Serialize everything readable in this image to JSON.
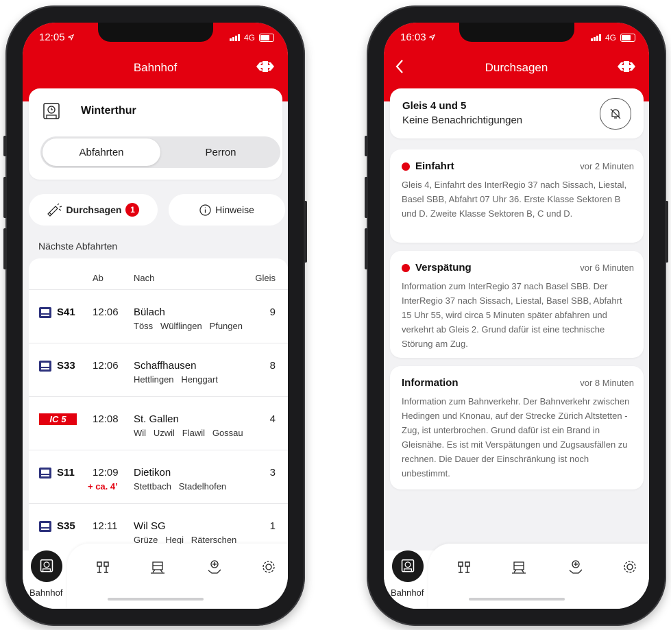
{
  "left_phone": {
    "status": {
      "time": "12:05",
      "network": "4G"
    },
    "header_title": "Bahnhof",
    "station_name": "Winterthur",
    "segments": {
      "active": "Abfahrten",
      "inactive": "Perron"
    },
    "pills": {
      "announcements": "Durchsagen",
      "announcements_count": "1",
      "notices": "Hinweise"
    },
    "section_label": "Nächste Abfahrten",
    "table_headers": {
      "ab": "Ab",
      "nach": "Nach",
      "gleis": "Gleis"
    },
    "departures": [
      {
        "line": "S41",
        "time": "12:06",
        "destination": "Bülach",
        "via": "Töss   Wülflingen   Pfungen",
        "platform": "9",
        "delay": ""
      },
      {
        "line": "S33",
        "time": "12:06",
        "destination": "Schaffhausen",
        "via": "Hettlingen   Henggart",
        "platform": "8",
        "delay": ""
      },
      {
        "line": "IC",
        "line_number": "5",
        "time": "12:08",
        "destination": "St. Gallen",
        "via": "Wil   Uzwil   Flawil   Gossau",
        "platform": "4",
        "delay": ""
      },
      {
        "line": "S11",
        "time": "12:09",
        "destination": "Dietikon",
        "via": "Stettbach   Stadelhofen",
        "platform": "3",
        "delay": "+ ca. 4’"
      },
      {
        "line": "S35",
        "time": "12:11",
        "destination": "Wil SG",
        "via": "Grüze   Hegi   Räterschen",
        "platform": "1",
        "delay": ""
      }
    ],
    "tabbar": {
      "active_label": "Bahnhof"
    }
  },
  "right_phone": {
    "status": {
      "time": "16:03",
      "network": "4G"
    },
    "header_title": "Durchsagen",
    "gleis": {
      "title": "Gleis 4 und 5",
      "subtitle": "Keine Benachrichtigungen"
    },
    "messages": [
      {
        "title": "Einfahrt",
        "time": "vor 2 Minuten",
        "body": "Gleis 4, Einfahrt des InterRegio 37 nach Sissach, Liestal, Basel SBB, Abfahrt 07 Uhr 36. Erste Klasse Sektoren B und D. Zweite Klasse Sektoren B, C und D."
      },
      {
        "title": "Verspätung",
        "time": "vor 6 Minuten",
        "body": "Information zum InterRegio 37 nach Basel SBB. Der InterRegio 37 nach Sissach, Liestal, Basel SBB, Abfahrt 15 Uhr 55, wird circa 5 Minuten später abfahren und verkehrt ab Gleis 2. Grund dafür ist eine technische Störung am Zug."
      },
      {
        "title": "Information",
        "time": "vor 8 Minuten",
        "body": "Information zum Bahnverkehr. Der Bahnverkehr zwischen Hedingen und Knonau, auf der Strecke Zürich Altstetten - Zug, ist unterbrochen. Grund dafür ist ein Brand in Gleisnähe. Es ist mit Verspätungen und Zugsausfällen zu rechnen. Die Dauer der Einschränkung ist noch unbestimmt."
      }
    ],
    "tabbar": {
      "active_label": "Bahnhof"
    }
  },
  "colors": {
    "sbb_red": "#e3000f",
    "sbb_blue": "#2d327d"
  },
  "icons": [
    "location-arrow-icon",
    "signal-icon",
    "battery-icon",
    "sbb-logo-icon",
    "station-clock-icon",
    "megaphone-icon",
    "info-icon",
    "train-icon",
    "back-chevron-icon",
    "bell-off-icon",
    "platform-icon",
    "ticket-icon",
    "assistance-icon",
    "settings-icon"
  ]
}
